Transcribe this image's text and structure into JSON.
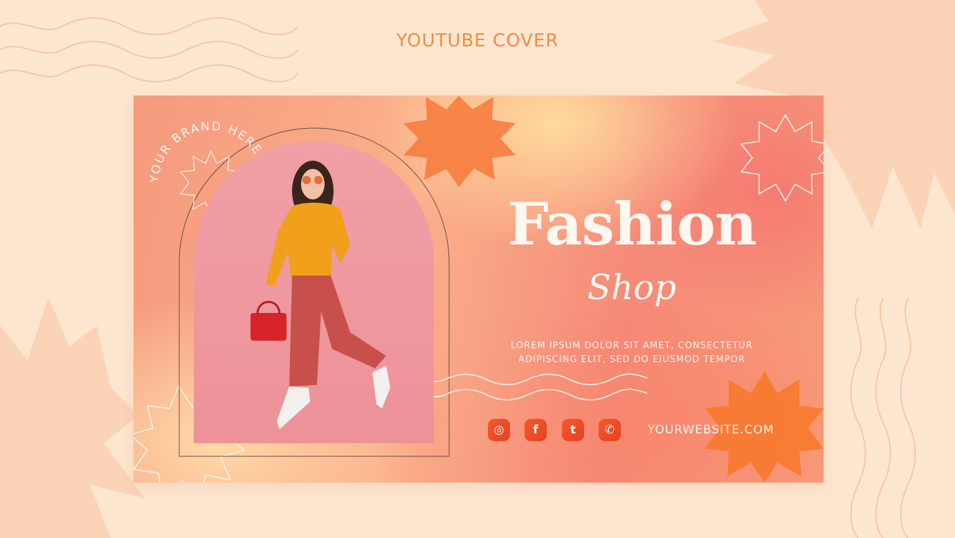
{
  "page": {
    "heading": "YOUTUBE COVER"
  },
  "cover": {
    "title": "Fashion",
    "subtitle": "Shop",
    "description_line1": "LOREM IPSUM DOLOR SIT AMET, CONSECTETUR",
    "description_line2": "ADIPISCING ELIT, SED DO EIUSMOD TEMPOR",
    "circular_badge_text": "YOUR BRAND HERE | YOUR BRAND |",
    "website": "YOURWEBSITE.COM",
    "socials": [
      {
        "name": "instagram-icon",
        "glyph": "◎"
      },
      {
        "name": "facebook-icon",
        "glyph": "f"
      },
      {
        "name": "twitter-icon",
        "glyph": "t"
      },
      {
        "name": "whatsapp-icon",
        "glyph": "✆"
      }
    ]
  },
  "colors": {
    "page_background": "#fde6cf",
    "heading": "#ec8e4a",
    "accent_orange": "#f7742e",
    "text_light": "#fff7f0"
  }
}
